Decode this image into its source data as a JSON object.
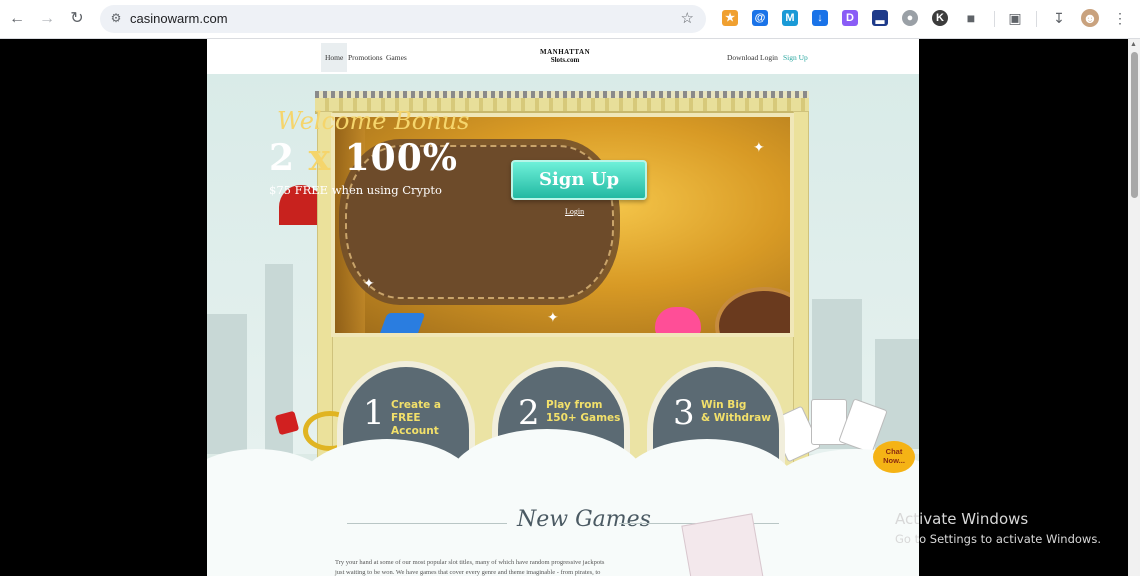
{
  "browser": {
    "url": "casinowarm.com",
    "back_icon": "arrow-left-icon",
    "forward_icon": "arrow-right-icon",
    "reload_icon": "reload-icon"
  },
  "site": {
    "nav": [
      "Home",
      "Promotions",
      "Games"
    ],
    "logo_line1": "MANHATTAN",
    "logo_line2": "Slots.com",
    "right_links": [
      "Download",
      "Login",
      "Sign Up"
    ]
  },
  "banner": {
    "title": "Welcome Bonus",
    "big_left": "2",
    "big_x": "x",
    "big_right": "100%",
    "subtitle": "$75 FREE when using Crypto",
    "signup_label": "Sign Up",
    "login_label": "Login"
  },
  "steps": [
    {
      "num": "1",
      "line1": "Create a",
      "line2": "FREE Account"
    },
    {
      "num": "2",
      "line1": "Play from",
      "line2": "150+ Games"
    },
    {
      "num": "3",
      "line1": "Win Big",
      "line2": "& Withdraw"
    }
  ],
  "chat": {
    "line1": "Chat",
    "line2": "Now..."
  },
  "new_games": {
    "title": "New Games",
    "paragraph_line1": "Try your hand at some of our most popular slot titles, many of which have random progressive jackpots",
    "paragraph_line2": "just waiting to be won. We have games that cover every genre and theme imaginable - from pirates, to"
  },
  "watermark": {
    "line1": "Activate Windows",
    "line2": "Go to Settings to activate Windows."
  }
}
